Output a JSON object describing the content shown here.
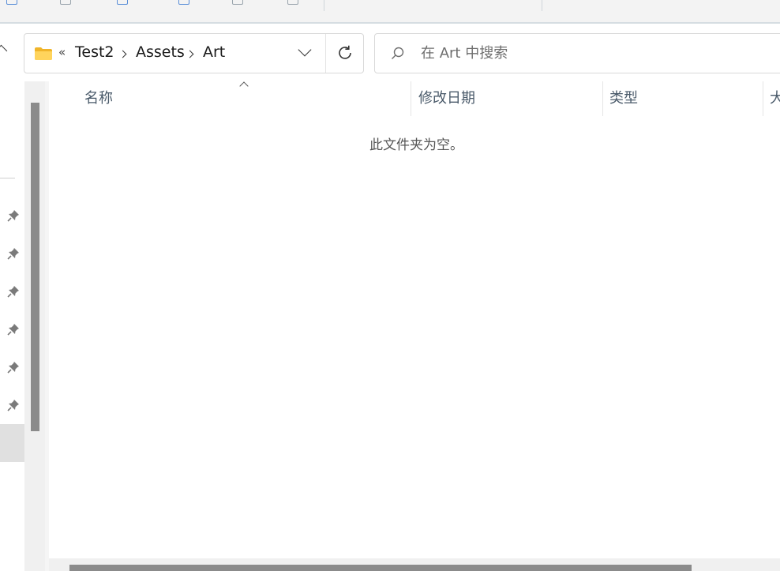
{
  "address": {
    "overflow_glyph": "«",
    "crumbs": [
      "Test2",
      "Assets",
      "Art"
    ]
  },
  "search": {
    "placeholder": "在 Art 中搜索",
    "value": ""
  },
  "columns": {
    "name": "名称",
    "modified": "修改日期",
    "type": "类型",
    "size": "大小"
  },
  "empty_message": "此文件夹为空。",
  "colors": {
    "accent": "#5b8fd8",
    "folder": "#f7c948",
    "scrollbar": "#8b8b8b"
  },
  "icons": {
    "folder": "folder-icon",
    "refresh": "refresh-icon",
    "search": "search-icon",
    "pin": "pin-icon",
    "dropdown": "chevron-down-icon"
  }
}
